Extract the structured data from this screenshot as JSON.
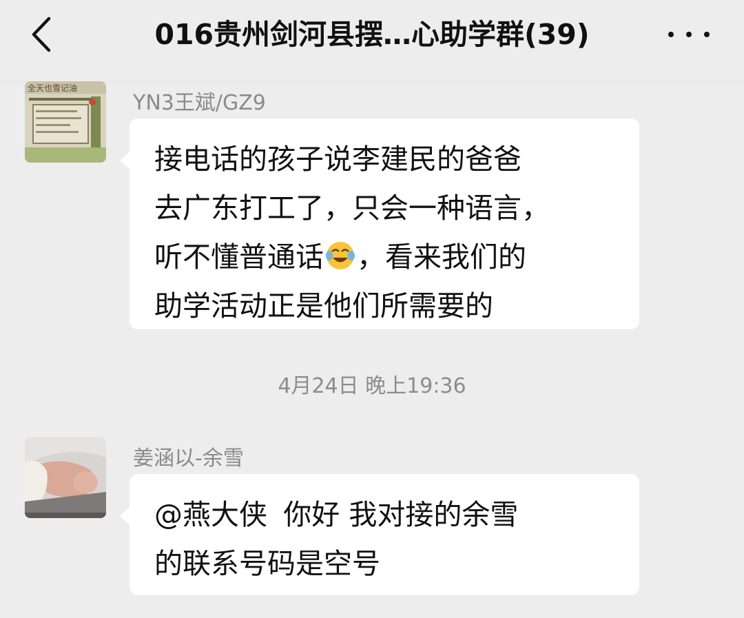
{
  "header": {
    "title": "016贵州剑河县摆…心助学群(39)",
    "back_icon": "chevron-left-icon",
    "more_icon": "more-horizontal-icon"
  },
  "messages": [
    {
      "sender": "YN3王斌/GZ9",
      "lines": [
        "接电话的孩子说李建民的爸爸",
        "去广东打工了，只会一种语言，",
        "听不懂普通话",
        "，看来我们的",
        "助学活动正是他们所需要的"
      ],
      "emoji": "face-with-tears-of-joy-emoji"
    },
    {
      "sender": "姜涵以-余雪",
      "lines": [
        "@燕大侠  你好 我对接的余雪",
        "的联系号码是空号"
      ]
    }
  ],
  "timestamp": "4月24日 晚上19:36",
  "colors": {
    "background": "#ededed",
    "bubble": "#ffffff",
    "text": "#111111",
    "meta_text": "#8a8a8a"
  }
}
